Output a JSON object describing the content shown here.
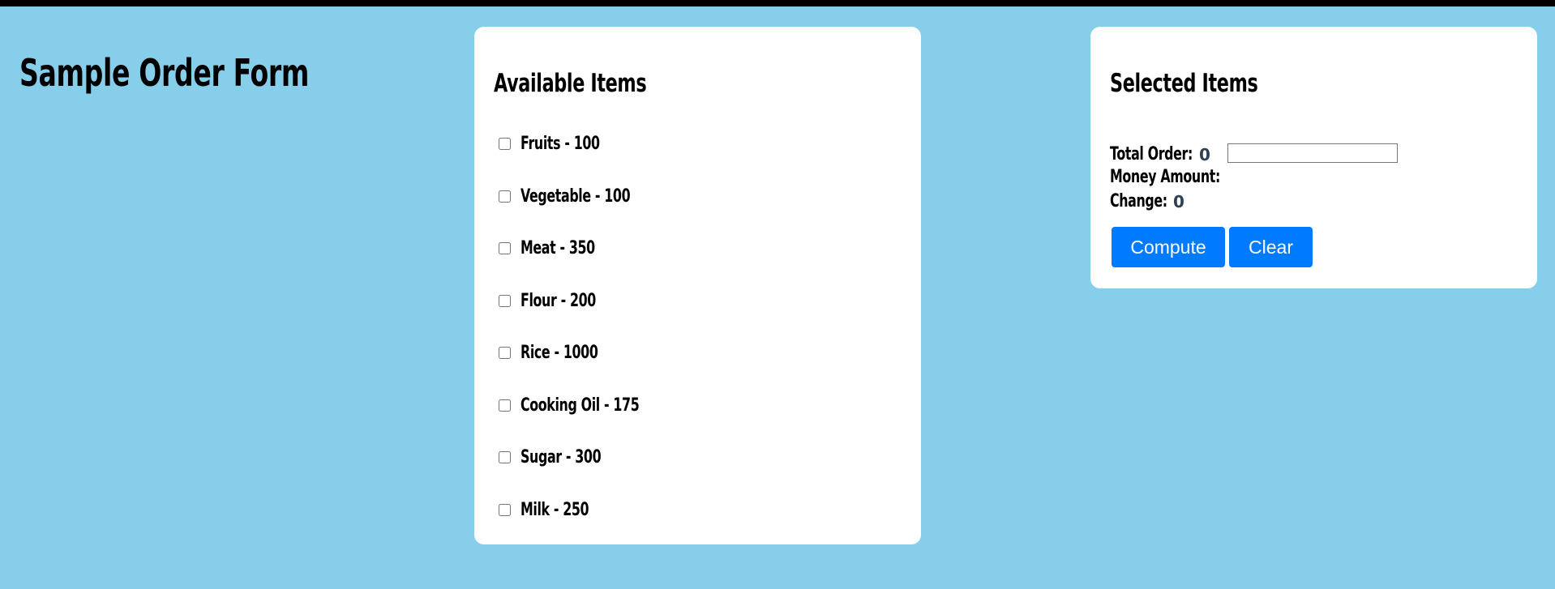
{
  "page": {
    "title": "Sample Order Form",
    "background_color": "#87ceeb"
  },
  "available": {
    "title": "Available Items",
    "items": [
      {
        "label": "Fruits - 100",
        "checked": false
      },
      {
        "label": "Vegetable - 100",
        "checked": false
      },
      {
        "label": "Meat - 350",
        "checked": false
      },
      {
        "label": "Flour - 200",
        "checked": false
      },
      {
        "label": "Rice - 1000",
        "checked": false
      },
      {
        "label": "Cooking Oil - 175",
        "checked": false
      },
      {
        "label": "Sugar - 300",
        "checked": false
      },
      {
        "label": "Milk - 250",
        "checked": false
      }
    ]
  },
  "selected": {
    "title": "Selected Items",
    "total_order_label": "Total Order:",
    "total_order_value": "0",
    "money_amount_label": "Money Amount:",
    "money_amount_value": "",
    "change_label": "Change:",
    "change_value": "0",
    "compute_label": "Compute",
    "clear_label": "Clear",
    "button_color": "#007bff"
  }
}
